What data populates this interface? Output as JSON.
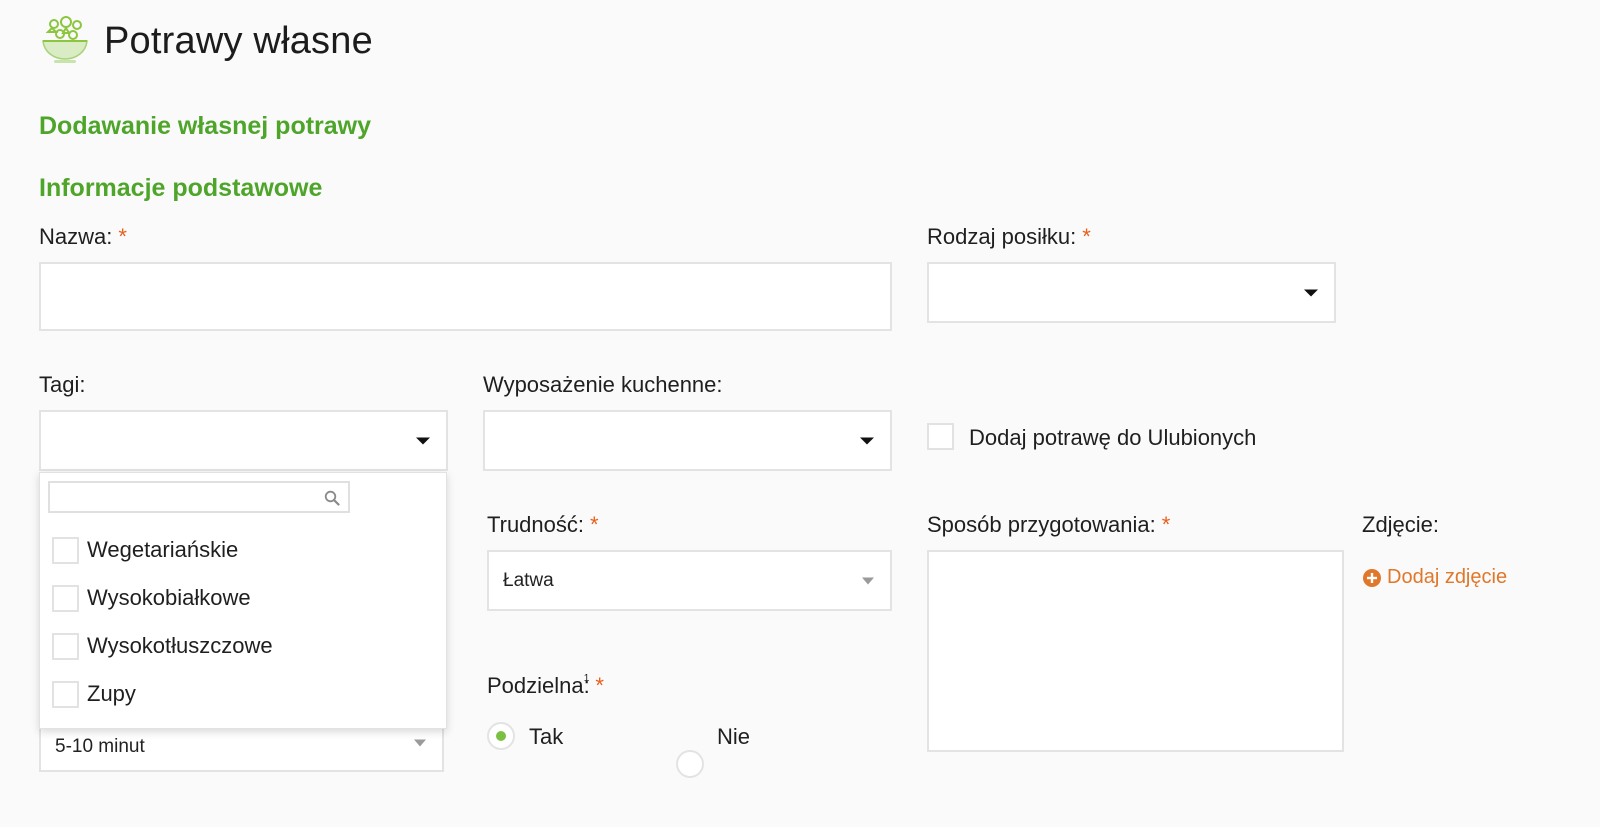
{
  "header": {
    "title": "Potrawy własne",
    "icon": "salad-bowl-icon"
  },
  "form": {
    "title": "Dodawanie własnej potrawy",
    "section_basic": "Informacje podstawowe",
    "required_mark": "*",
    "name": {
      "label": "Nazwa:",
      "value": ""
    },
    "meal_type": {
      "label": "Rodzaj posiłku:",
      "value": ""
    },
    "tags": {
      "label": "Tagi:",
      "value": "",
      "search_placeholder": "",
      "options": [
        {
          "label": "Wegetariańskie",
          "checked": false
        },
        {
          "label": "Wysokobiałkowe",
          "checked": false
        },
        {
          "label": "Wysokotłuszczowe",
          "checked": false
        },
        {
          "label": "Zupy",
          "checked": false
        }
      ]
    },
    "equipment": {
      "label": "Wyposażenie kuchenne:",
      "value": ""
    },
    "favorite": {
      "label": "Dodaj potrawę do Ulubionych",
      "checked": false
    },
    "difficulty": {
      "label": "Trudność:",
      "value": "Łatwa"
    },
    "time": {
      "value": "5-10 minut"
    },
    "divisible": {
      "label": "Podzielna:",
      "footnote": "1",
      "options": [
        {
          "label": "Tak",
          "selected": true
        },
        {
          "label": "Nie",
          "selected": false
        }
      ]
    },
    "preparation": {
      "label": "Sposób przygotowania:",
      "value": ""
    },
    "photo": {
      "label": "Zdjęcie:",
      "add_label": "Dodaj zdjęcie"
    }
  },
  "colors": {
    "accent_green": "#4ea52a",
    "required_orange": "#e85f1b",
    "link_orange": "#e0772a",
    "radio_green": "#7ac143"
  }
}
